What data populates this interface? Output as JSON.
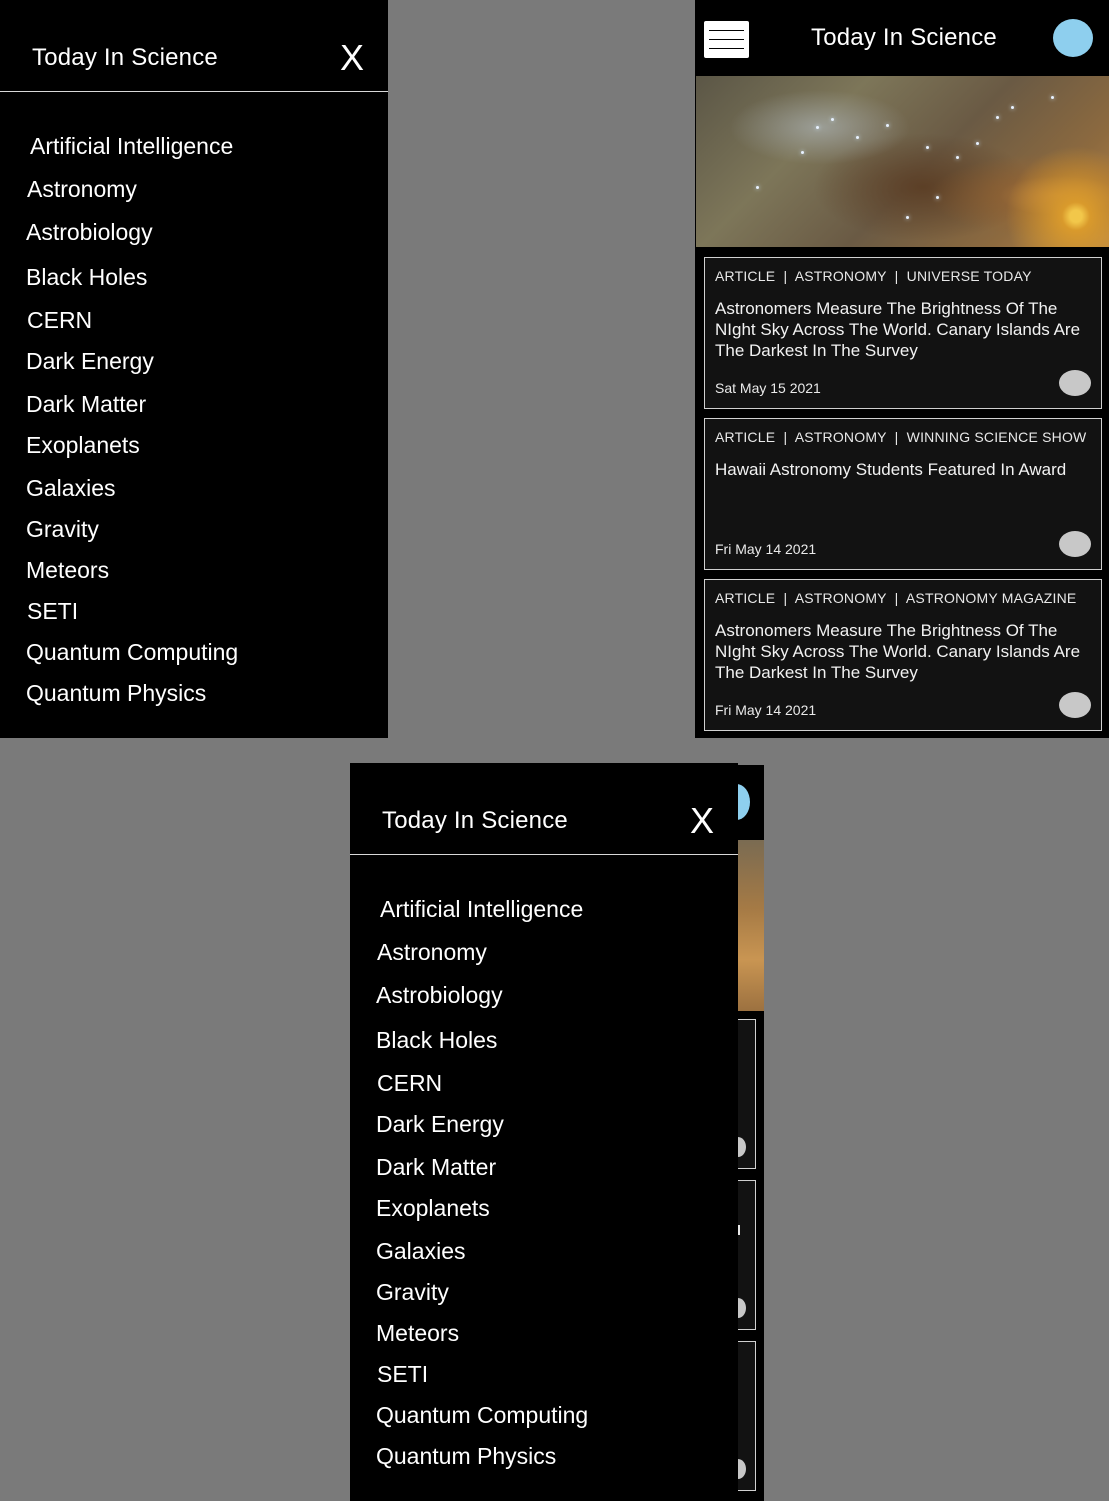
{
  "drawer": {
    "title": "Today In Science",
    "close_label": "X",
    "topics": [
      "Artificial Intelligence",
      "Astronomy",
      "Astrobiology",
      "Black Holes",
      "CERN",
      "Dark Energy",
      "Dark Matter",
      "Exoplanets",
      "Galaxies",
      "Gravity",
      "Meteors",
      "SETI",
      "Quantum Computing",
      "Quantum Physics"
    ]
  },
  "app": {
    "title": "Today In Science",
    "menu_icon": "hamburger-icon",
    "avatar_color": "#8ecfee",
    "articles": [
      {
        "meta": "ARTICLE  |  ASTRONOMY  |  UNIVERSE TODAY",
        "headline": "Astronomers Measure The Brightness Of The NIght Sky Across The World. Canary Islands Are The Darkest In The Survey",
        "date": "Sat May 15 2021"
      },
      {
        "meta": "ARTICLE  |  ASTRONOMY  |  WINNING SCIENCE SHOW",
        "headline": "Hawaii Astronomy Students Featured In Award",
        "date": "Fri May 14 2021"
      },
      {
        "meta": "ARTICLE  |  ASTRONOMY  |  ASTRONOMY MAGAZINE",
        "headline": "Astronomers Measure The Brightness Of The NIght Sky Across The World. Canary Islands Are The Darkest In The Survey",
        "date": "Fri May 14 2021"
      }
    ]
  }
}
